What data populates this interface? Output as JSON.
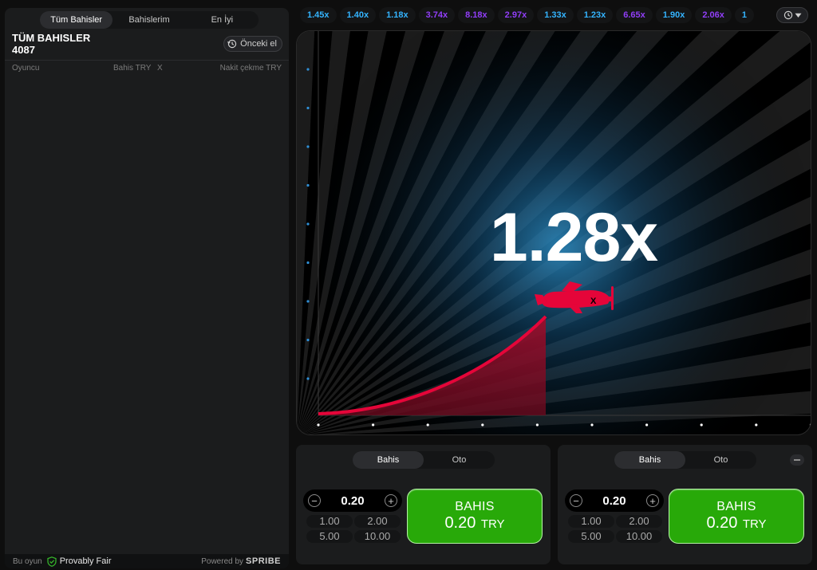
{
  "left_panel": {
    "tabs": [
      {
        "label": "Tüm Bahisler",
        "active": true
      },
      {
        "label": "Bahislerim",
        "active": false
      },
      {
        "label": "En İyi",
        "active": false
      }
    ],
    "title": "TÜM BAHISLER",
    "count": "4087",
    "previous_button": "Önceki el",
    "columns": {
      "player": "Oyuncu",
      "bet": "Bahis TRY",
      "x": "X",
      "cashout": "Nakit çekme TRY"
    },
    "footer": {
      "this_game": "Bu oyun",
      "provably_fair": "Provably Fair",
      "powered_by": "Powered by",
      "brand": "SPRIBE"
    }
  },
  "history": [
    {
      "value": "1.45x",
      "color": "#34b4ff"
    },
    {
      "value": "1.40x",
      "color": "#34b4ff"
    },
    {
      "value": "1.18x",
      "color": "#34b4ff"
    },
    {
      "value": "3.74x",
      "color": "#913ef8"
    },
    {
      "value": "8.18x",
      "color": "#913ef8"
    },
    {
      "value": "2.97x",
      "color": "#913ef8"
    },
    {
      "value": "1.33x",
      "color": "#34b4ff"
    },
    {
      "value": "1.23x",
      "color": "#34b4ff"
    },
    {
      "value": "6.65x",
      "color": "#913ef8"
    },
    {
      "value": "1.90x",
      "color": "#34b4ff"
    },
    {
      "value": "2.06x",
      "color": "#913ef8"
    },
    {
      "value": "1",
      "color": "#34b4ff"
    }
  ],
  "game": {
    "multiplier": "1.28x",
    "curve_color": "#e50539",
    "plane_color": "#e50539",
    "axis_dot_color_y": "#2f8fd6",
    "axis_dot_color_x": "#ffffff"
  },
  "bet_panels": [
    {
      "tabs": [
        {
          "label": "Bahis",
          "active": true
        },
        {
          "label": "Oto",
          "active": false
        }
      ],
      "amount": "0.20",
      "quick": [
        "1.00",
        "2.00",
        "5.00",
        "10.00"
      ],
      "button_label": "BAHIS",
      "button_amount": "0.20",
      "button_currency": "TRY"
    },
    {
      "tabs": [
        {
          "label": "Bahis",
          "active": true
        },
        {
          "label": "Oto",
          "active": false
        }
      ],
      "amount": "0.20",
      "quick": [
        "1.00",
        "2.00",
        "5.00",
        "10.00"
      ],
      "button_label": "BAHIS",
      "button_amount": "0.20",
      "button_currency": "TRY"
    }
  ]
}
